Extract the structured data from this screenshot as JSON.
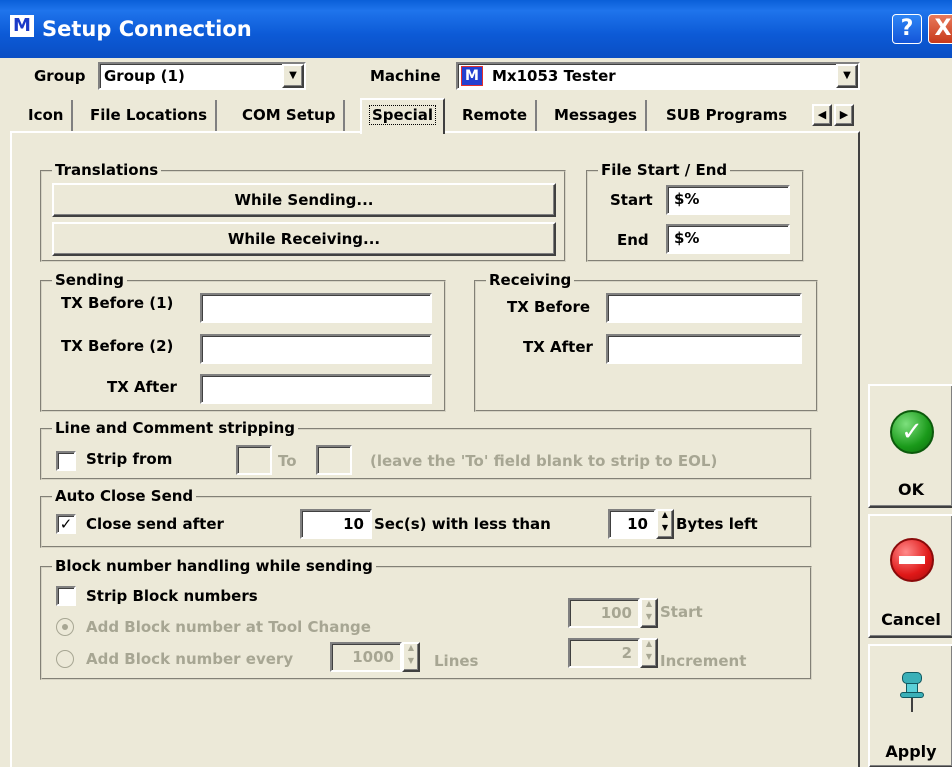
{
  "window": {
    "title": "Setup Connection",
    "help": "?",
    "close": "X",
    "icon_text": "M"
  },
  "header": {
    "group_label": "Group",
    "group_value": "Group (1)",
    "machine_label": "Machine",
    "machine_value": "Mx1053 Tester",
    "machine_icon_text": "M"
  },
  "tabs": [
    {
      "label": "Icon"
    },
    {
      "label": "File Locations"
    },
    {
      "label": "COM Setup"
    },
    {
      "label": "Special"
    },
    {
      "label": "Remote"
    },
    {
      "label": "Messages"
    },
    {
      "label": "SUB Programs"
    }
  ],
  "translations": {
    "title": "Translations",
    "sending_btn": "While Sending...",
    "receiving_btn": "While Receiving..."
  },
  "file_start_end": {
    "title": "File Start / End",
    "start_label": "Start",
    "start_value": "$%",
    "end_label": "End",
    "end_value": "$%"
  },
  "sending": {
    "title": "Sending",
    "tx_before1_label": "TX Before (1)",
    "tx_before2_label": "TX Before (2)",
    "tx_after_label": "TX After",
    "tx_before1_value": "",
    "tx_before2_value": "",
    "tx_after_value": ""
  },
  "receiving": {
    "title": "Receiving",
    "tx_before_label": "TX Before",
    "tx_after_label": "TX After",
    "tx_before_value": "",
    "tx_after_value": ""
  },
  "stripping": {
    "title": "Line and Comment stripping",
    "strip_from_label": "Strip from",
    "strip_from_checked": false,
    "to_label": "To",
    "hint": "(leave the 'To' field blank to strip to EOL)"
  },
  "auto_close": {
    "title": "Auto Close Send",
    "close_after_label": "Close send after",
    "close_after_checked": true,
    "check_mark": "✓",
    "seconds_value": "10",
    "seconds_label": "Sec(s) with less than",
    "bytes_value": "10",
    "bytes_label": "Bytes left"
  },
  "block": {
    "title": "Block number handling while sending",
    "strip_label": "Strip Block numbers",
    "strip_checked": false,
    "tool_change_label": "Add Block number at Tool Change",
    "every_label": "Add Block number every",
    "every_value": "1000",
    "lines_label": "Lines",
    "start_value": "100",
    "start_label": "Start",
    "increment_value": "2",
    "increment_label": "Increment"
  },
  "side_buttons": {
    "ok": "OK",
    "cancel": "Cancel",
    "apply": "Apply"
  },
  "colors": {
    "titlebar": "#0a5fd8",
    "ok": "#1a9a1a",
    "cancel": "#e01818",
    "dialog_bg": "#ece9d8"
  }
}
